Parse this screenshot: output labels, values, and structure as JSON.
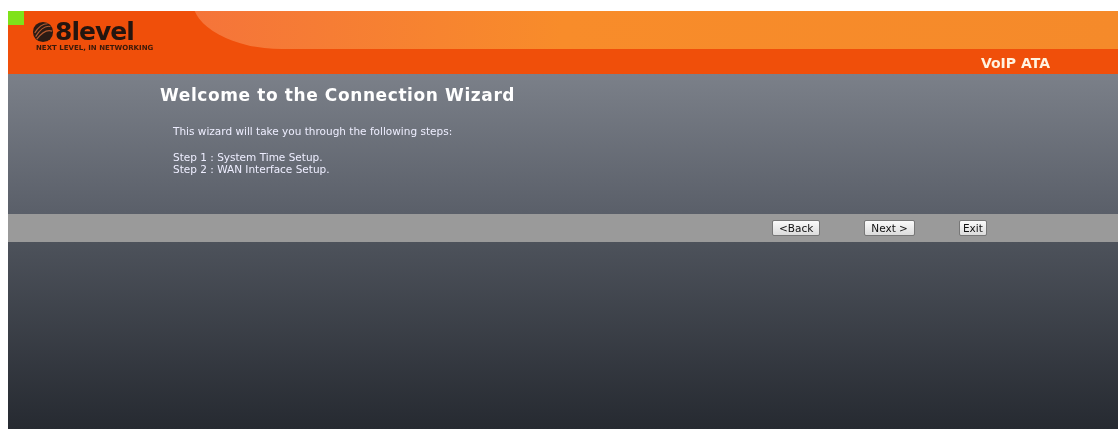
{
  "header": {
    "logo": {
      "wordmark": "8level",
      "tagline": "NEXT LEVEL, IN NETWORKING"
    },
    "product": "VoIP ATA"
  },
  "wizard": {
    "title": "Welcome to the Connection Wizard",
    "intro": "This wizard will take you through the following steps:",
    "steps": [
      "Step 1 : System Time Setup.",
      "Step 2 : WAN Interface Setup."
    ]
  },
  "buttons": [
    {
      "label": "<Back"
    },
    {
      "label": "Next >"
    },
    {
      "label": "Exit"
    }
  ]
}
